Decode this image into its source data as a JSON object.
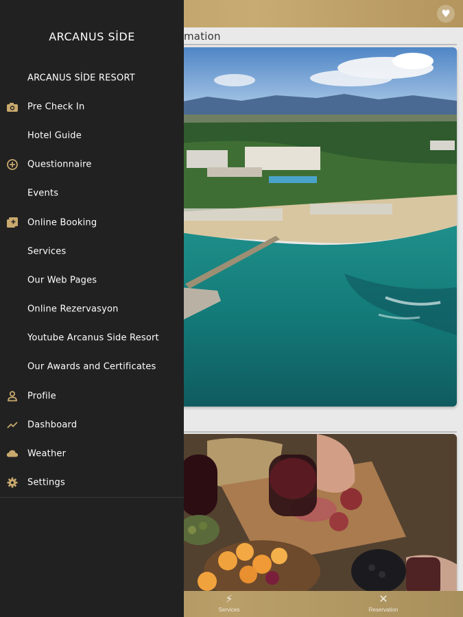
{
  "colors": {
    "drawer_bg": "#212121",
    "header_gold": "#c7ab73",
    "icon_gold": "#c9a96e",
    "text": "#ffffff"
  },
  "header": {
    "favorite_icon": "heart-icon"
  },
  "main": {
    "section_title": "mation"
  },
  "drawer": {
    "title": "ARCANUS SİDE",
    "items": [
      {
        "label": "ARCANUS SİDE RESORT",
        "icon": ""
      },
      {
        "label": "Pre Check In",
        "icon": "camera-icon"
      },
      {
        "label": "Hotel Guide",
        "icon": ""
      },
      {
        "label": "Questionnaire",
        "icon": "plus-circle-icon"
      },
      {
        "label": "Events",
        "icon": ""
      },
      {
        "label": "Online Booking",
        "icon": "library-add-icon"
      },
      {
        "label": "Services",
        "icon": ""
      },
      {
        "label": "Our Web Pages",
        "icon": ""
      },
      {
        "label": "Online Rezervasyon",
        "icon": ""
      },
      {
        "label": "Youtube Arcanus Side Resort",
        "icon": ""
      },
      {
        "label": "Our Awards and Certificates",
        "icon": ""
      },
      {
        "label": "Profile",
        "icon": "person-icon"
      },
      {
        "label": "Dashboard",
        "icon": "trending-icon"
      },
      {
        "label": "Weather",
        "icon": "cloud-icon"
      },
      {
        "label": "Settings",
        "icon": "gear-icon"
      }
    ]
  },
  "bottom_nav": {
    "services_label": "Services",
    "reservation_label": "Reservation"
  }
}
